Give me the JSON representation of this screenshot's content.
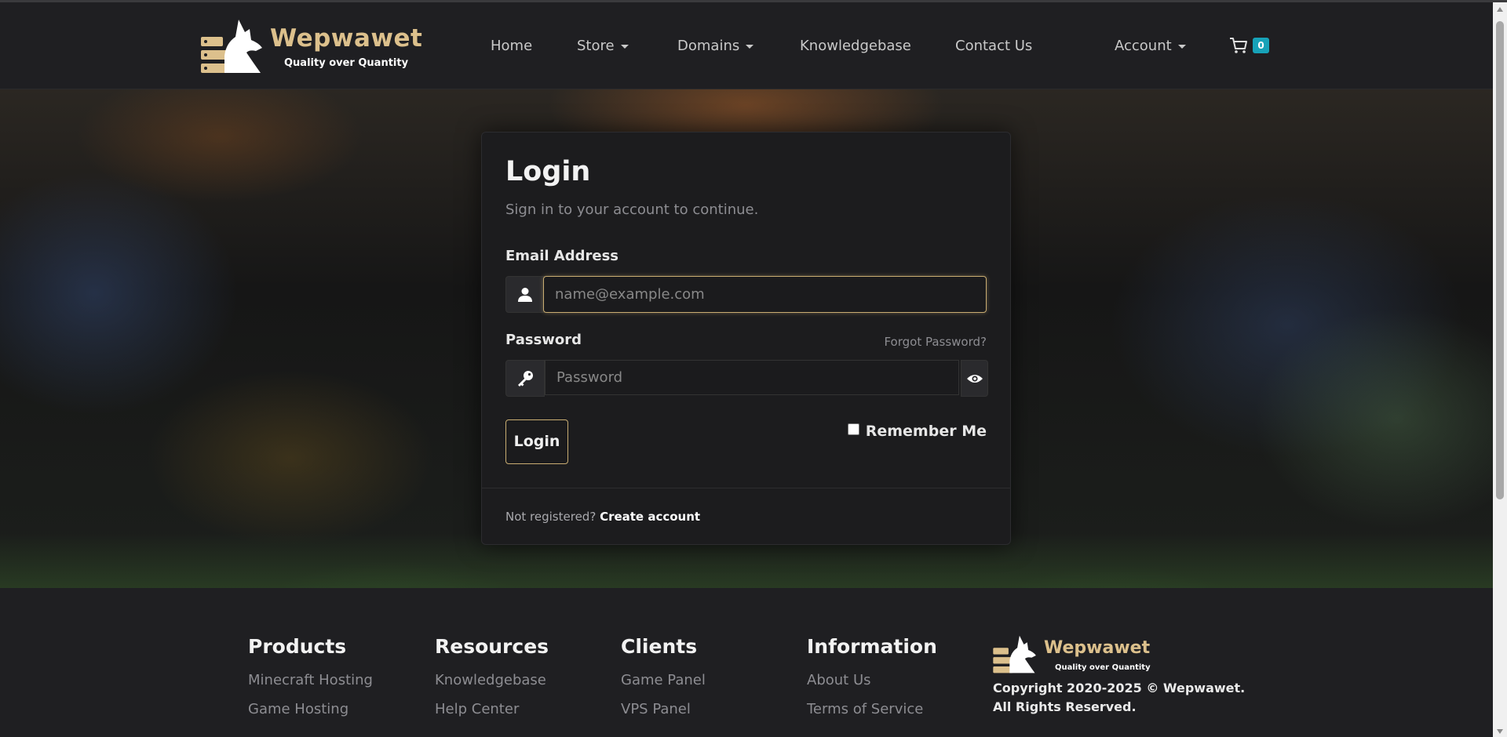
{
  "brand": {
    "name": "Wepwawet",
    "tagline": "Quality over Quantity"
  },
  "nav": {
    "items": [
      {
        "label": "Home"
      },
      {
        "label": "Store"
      },
      {
        "label": "Domains"
      },
      {
        "label": "Knowledgebase"
      },
      {
        "label": "Contact Us"
      }
    ],
    "account_label": "Account",
    "cart_count": "0"
  },
  "login": {
    "title": "Login",
    "subtitle": "Sign in to your account to continue.",
    "email_label": "Email Address",
    "email_placeholder": "name@example.com",
    "password_label": "Password",
    "password_placeholder": "Password",
    "forgot_label": "Forgot Password?",
    "submit_label": "Login",
    "remember_label": "Remember Me",
    "not_registered": "Not registered?",
    "create_account": "Create account"
  },
  "footer": {
    "columns": [
      {
        "title": "Products",
        "links": [
          "Minecraft Hosting",
          "Game Hosting"
        ]
      },
      {
        "title": "Resources",
        "links": [
          "Knowledgebase",
          "Help Center"
        ]
      },
      {
        "title": "Clients",
        "links": [
          "Game Panel",
          "VPS Panel"
        ]
      },
      {
        "title": "Information",
        "links": [
          "About Us",
          "Terms of Service"
        ]
      }
    ],
    "copyright": "Copyright 2020-2025 © Wepwawet. All Rights Reserved."
  },
  "colors": {
    "accent": "#dcc08c",
    "badge": "#17a2b8",
    "background": "#1f1f22"
  },
  "icons": [
    "wolf-logo-icon",
    "cart-icon",
    "user-icon",
    "key-icon",
    "eye-icon"
  ]
}
